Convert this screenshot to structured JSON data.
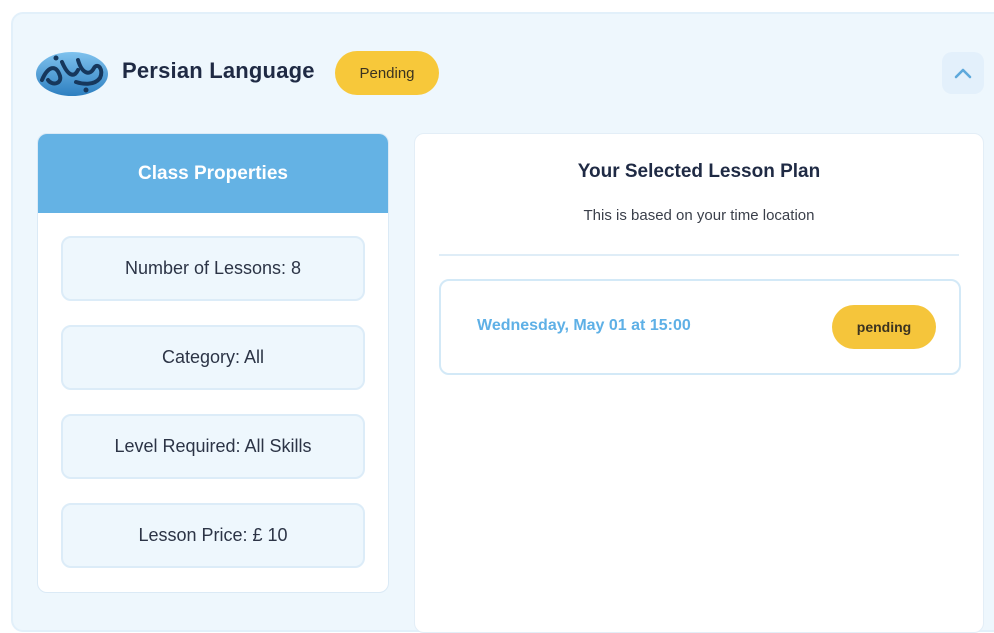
{
  "course": {
    "title": "Persian Language",
    "status": "Pending",
    "logo_icon": "persian-calligraphy-logo",
    "collapse_icon": "chevron-up-icon"
  },
  "properties": {
    "header": "Class Properties",
    "items": [
      {
        "label": "Number of Lessons: 8"
      },
      {
        "label": "Category: All"
      },
      {
        "label": "Level Required: All Skills"
      },
      {
        "label": "Lesson Price: £ 10"
      }
    ]
  },
  "lesson_plan": {
    "title": "Your Selected Lesson Plan",
    "subtitle": "This is based on your time location",
    "lessons": [
      {
        "datetime": "Wednesday, May 01 at 15:00",
        "status": "pending"
      }
    ]
  },
  "colors": {
    "accent": "#64b2e4",
    "pending": "#f7c83a",
    "background": "#eef7fd"
  }
}
